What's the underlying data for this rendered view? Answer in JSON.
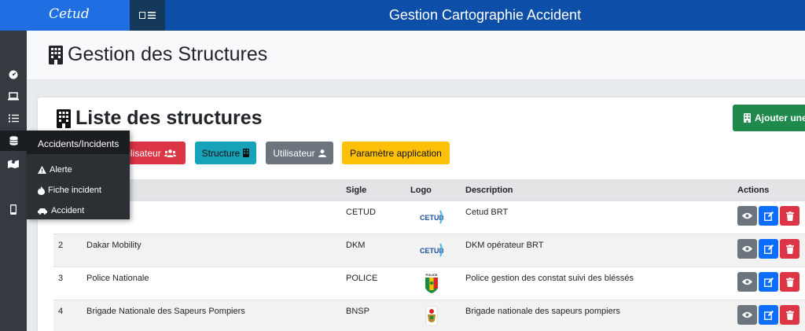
{
  "brand": "Cetud",
  "app_title": "Gestion Cartographie Accident",
  "page_title": "Gestion des Structures",
  "card": {
    "title": "Liste des structures",
    "add_label": "Ajouter une"
  },
  "tabs": {
    "user_group": "tilisateur",
    "structure": "Structure",
    "utilisateur": "Utilisateur",
    "parametre": "Paramètre application"
  },
  "flyout": {
    "header": "Accidents/Incidents",
    "items": [
      "Alerte",
      "Fiche incident",
      "Accident"
    ]
  },
  "table": {
    "headers": {
      "sigle": "Sigle",
      "logo": "Logo",
      "description": "Description",
      "actions": "Actions"
    },
    "rows": [
      {
        "num": "",
        "name": "",
        "sigle": "CETUD",
        "logo": "CETUD",
        "description": "Cetud BRT"
      },
      {
        "num": "2",
        "name": "Dakar Mobility",
        "sigle": "DKM",
        "logo": "CETUD",
        "description": "DKM opérateur BRT"
      },
      {
        "num": "3",
        "name": "Police Nationale",
        "sigle": "POLICE",
        "logo": "POLICE",
        "description": "Police gestion des constat suivi des bléssés"
      },
      {
        "num": "4",
        "name": "Brigade Nationale des Sapeurs Pompiers",
        "sigle": "BNSP",
        "logo": "BNSP",
        "description": "Brigade nationale des sapeurs pompiers"
      }
    ]
  },
  "colors": {
    "topbar": "#0d4ea8",
    "brand_bg": "#1f6fe3",
    "sidebar": "#343a40",
    "success": "#1f8a4c",
    "danger": "#dc3545",
    "info": "#17a2b8",
    "secondary": "#6c757d",
    "warning": "#ffc107",
    "primary": "#0d6efd"
  },
  "icons": [
    "dashboard-icon",
    "laptop-icon",
    "list-icon",
    "database-icon",
    "map-icon",
    "mobile-icon",
    "building-icon",
    "users-icon",
    "warning-icon",
    "fire-icon",
    "car-crash-icon",
    "eye-icon",
    "edit-icon",
    "trash-icon"
  ]
}
